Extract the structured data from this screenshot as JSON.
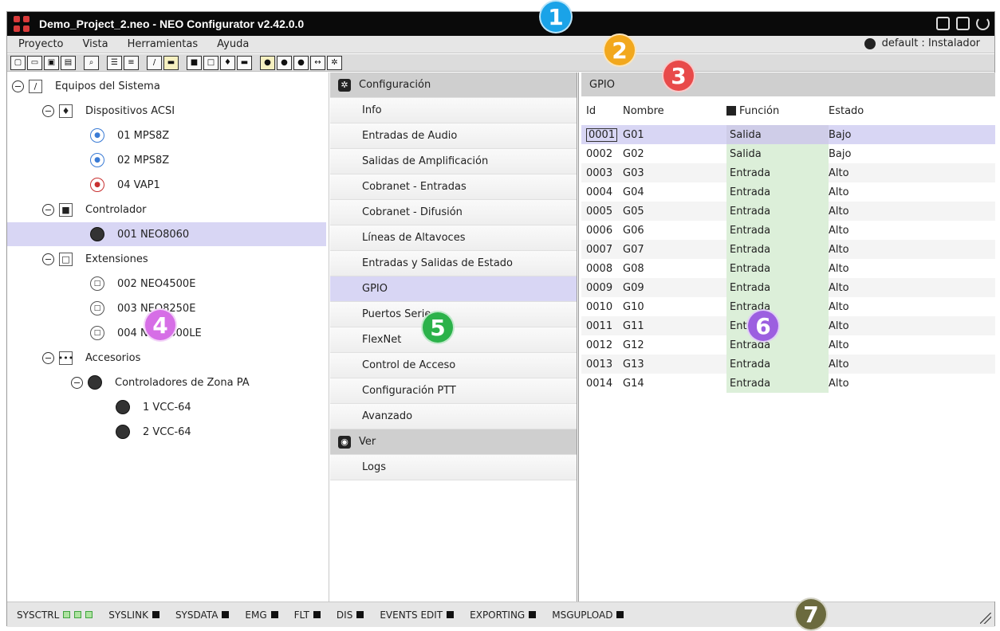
{
  "title": "Demo_Project_2.neo - NEO Configurator v2.42.0.0",
  "menu": [
    "Proyecto",
    "Vista",
    "Herramientas",
    "Ayuda"
  ],
  "user": "default : Instalador",
  "tree": [
    {
      "label": "Equipos del Sistema",
      "icon": "pencil-icon"
    },
    {
      "label": "Dispositivos ACSI",
      "icon": "microphone-icon"
    },
    {
      "label": "01 MPS8Z",
      "icon": "mic-device-icon"
    },
    {
      "label": "02 MPS8Z",
      "icon": "mic-device-icon"
    },
    {
      "label": "04 VAP1",
      "icon": "speaker-device-icon"
    },
    {
      "label": "Controlador",
      "icon": "monitor-icon"
    },
    {
      "label": "001 NEO8060",
      "icon": "controller-icon"
    },
    {
      "label": "Extensiones",
      "icon": "extension-icon"
    },
    {
      "label": "002 NEO4500E",
      "icon": "extension-device-icon"
    },
    {
      "label": "003 NEO8250E",
      "icon": "extension-device-icon"
    },
    {
      "label": "004 NEO4500LE",
      "icon": "extension-device-icon"
    },
    {
      "label": "Accesorios",
      "icon": "dots-icon"
    },
    {
      "label": "Controladores de Zona PA",
      "icon": "zone-icon"
    },
    {
      "label": "1 VCC-64",
      "icon": "vcc-icon"
    },
    {
      "label": "2 VCC-64",
      "icon": "vcc-icon"
    }
  ],
  "middle": {
    "config_header": "Configuración",
    "items": [
      "Info",
      "Entradas de Audio",
      "Salidas de Amplificación",
      "Cobranet - Entradas",
      "Cobranet - Difusión",
      "Líneas de Altavoces",
      "Entradas y Salidas de Estado",
      "GPIO",
      "Puertos Serie",
      "FlexNet",
      "Control de Acceso",
      "Configuración PTT",
      "Avanzado"
    ],
    "view_header": "Ver",
    "view_items": [
      "Logs"
    ]
  },
  "right": {
    "header": "GPIO",
    "columns": [
      "Id",
      "Nombre",
      "Función",
      "Estado"
    ],
    "rows": [
      [
        "0001",
        "G01",
        "Salida",
        "Bajo"
      ],
      [
        "0002",
        "G02",
        "Salida",
        "Bajo"
      ],
      [
        "0003",
        "G03",
        "Entrada",
        "Alto"
      ],
      [
        "0004",
        "G04",
        "Entrada",
        "Alto"
      ],
      [
        "0005",
        "G05",
        "Entrada",
        "Alto"
      ],
      [
        "0006",
        "G06",
        "Entrada",
        "Alto"
      ],
      [
        "0007",
        "G07",
        "Entrada",
        "Alto"
      ],
      [
        "0008",
        "G08",
        "Entrada",
        "Alto"
      ],
      [
        "0009",
        "G09",
        "Entrada",
        "Alto"
      ],
      [
        "0010",
        "G10",
        "Entrada",
        "Alto"
      ],
      [
        "0011",
        "G11",
        "Entrada",
        "Alto"
      ],
      [
        "0012",
        "G12",
        "Entrada",
        "Alto"
      ],
      [
        "0013",
        "G13",
        "Entrada",
        "Alto"
      ],
      [
        "0014",
        "G14",
        "Entrada",
        "Alto"
      ]
    ]
  },
  "status": [
    "SYSCTRL",
    "SYSLINK",
    "SYSDATA",
    "EMG",
    "FLT",
    "DIS",
    "EVENTS EDIT",
    "EXPORTING",
    "MSGUPLOAD"
  ],
  "callouts": [
    {
      "n": "1",
      "color": "#1aa3e8"
    },
    {
      "n": "2",
      "color": "#f2a81d"
    },
    {
      "n": "3",
      "color": "#e84a4a"
    },
    {
      "n": "4",
      "color": "#d66ee6"
    },
    {
      "n": "5",
      "color": "#2bb24a"
    },
    {
      "n": "6",
      "color": "#9c5fe0"
    },
    {
      "n": "7",
      "color": "#6b6a3e"
    }
  ]
}
